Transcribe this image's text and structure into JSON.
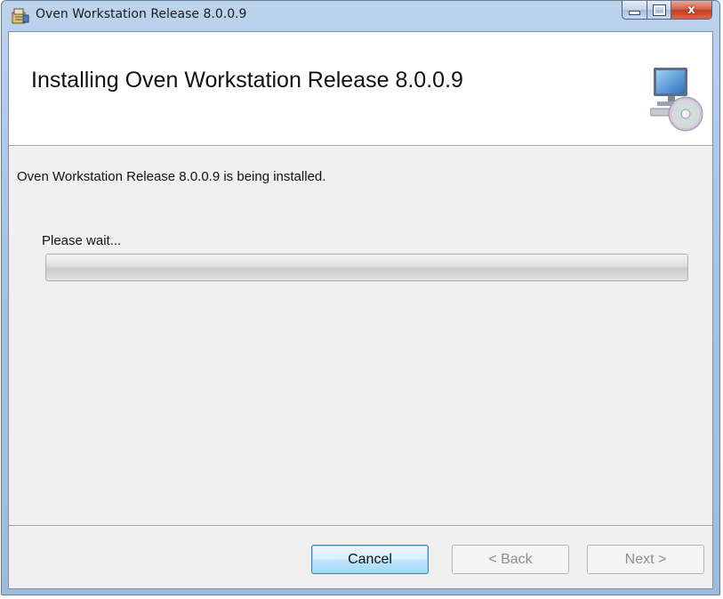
{
  "window": {
    "title": "Oven Workstation Release 8.0.0.9",
    "close_glyph": "x"
  },
  "banner": {
    "heading": "Installing Oven Workstation Release 8.0.0.9",
    "icon": "computer-cd-icon"
  },
  "body": {
    "status": "Oven Workstation Release 8.0.0.9 is being installed.",
    "wait_label": "Please wait...",
    "progress_fraction": 0
  },
  "buttons": {
    "cancel": "Cancel",
    "back": "< Back",
    "next": "Next >"
  },
  "colors": {
    "client_background": "#f0f0f0",
    "banner_background": "#ffffff",
    "focused_button_border": "#3c7fb1",
    "disabled_text": "#8d8d8d"
  }
}
